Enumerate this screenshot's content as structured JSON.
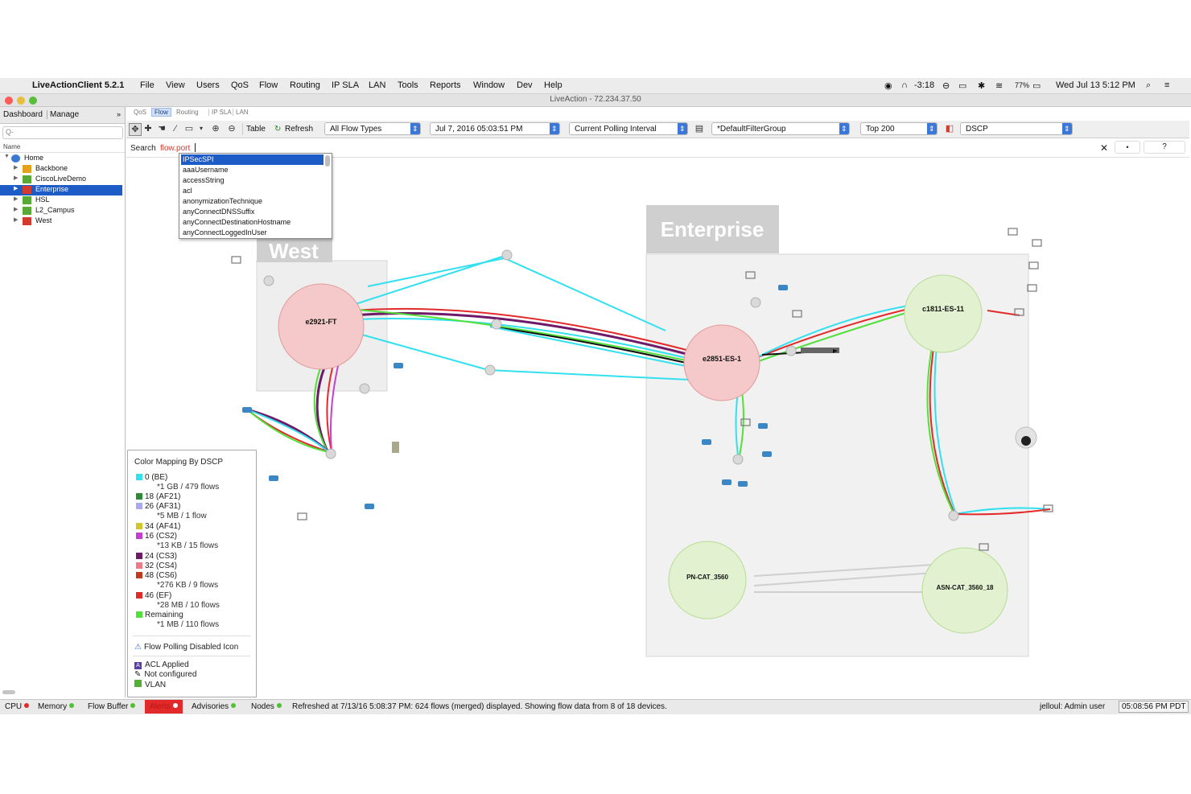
{
  "menubar": {
    "app_name": "LiveActionClient 5.2.1",
    "menus": [
      "File",
      "View",
      "Users",
      "QoS",
      "Flow",
      "Routing",
      "IP SLA",
      "LAN",
      "Tools",
      "Reports",
      "Window",
      "Dev",
      "Help"
    ],
    "time_remaining": "-3:18",
    "battery": "77%",
    "clock": "Wed Jul 13  5:12 PM"
  },
  "window": {
    "title": "LiveAction - 72.234.37.50"
  },
  "left_panel": {
    "tabs": [
      "Dashboard",
      "Manage"
    ],
    "search_placeholder": "Q-",
    "tree_header": "Name",
    "tree": [
      {
        "label": "Home",
        "color": "#3b78d4"
      },
      {
        "label": "Backbone",
        "color": "#e5a11c"
      },
      {
        "label": "CiscoLiveDemo",
        "color": "#58a935"
      },
      {
        "label": "Enterprise",
        "color": "#d33b2e"
      },
      {
        "label": "HSL",
        "color": "#58a935"
      },
      {
        "label": "L2_Campus",
        "color": "#58a935"
      },
      {
        "label": "West",
        "color": "#d33b2e"
      }
    ]
  },
  "view_tabs": [
    "QoS",
    "Flow",
    "Routing",
    "IP SLA",
    "LAN"
  ],
  "toolbar": {
    "table_label": "Table",
    "refresh_label": "Refresh",
    "flow_types": "All Flow Types",
    "datetime": "Jul 7, 2016 05:03:51 PM",
    "interval": "Current Polling Interval",
    "filter_group": "*DefaultFilterGroup",
    "top_n": "Top 200",
    "color_by": "DSCP"
  },
  "search": {
    "label": "Search",
    "query": "flow.port",
    "help": "?",
    "suggestions": [
      "IPSecSPI",
      "aaaUsername",
      "accessString",
      "acl",
      "anonymizationTechnique",
      "anyConnectDNSSuffix",
      "anyConnectDestinationHostname",
      "anyConnectLoggedInUser"
    ]
  },
  "map": {
    "groups": [
      {
        "name": "West"
      },
      {
        "name": "Enterprise"
      }
    ],
    "routers": [
      {
        "name": "e2921-FT",
        "color": "red"
      },
      {
        "name": "e2851-ES-1",
        "color": "red"
      },
      {
        "name": "c1811-ES-11",
        "color": "green"
      },
      {
        "name": "PN-CAT_3560",
        "color": "green"
      },
      {
        "name": "ASN-CAT_3560_18",
        "color": "green"
      }
    ]
  },
  "legend": {
    "title": "Color Mapping By DSCP",
    "entries": [
      {
        "label": "0 (BE)",
        "color": "#33e0ef",
        "detail": "*1 GB / 479 flows"
      },
      {
        "label": "18 (AF21)",
        "color": "#2f8a35",
        "detail": ""
      },
      {
        "label": "26 (AF31)",
        "color": "#a9a9ef",
        "detail": "*5 MB / 1 flow"
      },
      {
        "label": "34 (AF41)",
        "color": "#d2c62a",
        "detail": ""
      },
      {
        "label": "16 (CS2)",
        "color": "#c63ecf",
        "detail": "*13 KB / 15 flows"
      },
      {
        "label": "24 (CS3)",
        "color": "#6e1a68",
        "detail": ""
      },
      {
        "label": "32 (CS4)",
        "color": "#ef7a86",
        "detail": ""
      },
      {
        "label": "48 (CS6)",
        "color": "#c23a1e",
        "detail": "*276 KB / 9 flows"
      },
      {
        "label": "46 (EF)",
        "color": "#e22a2a",
        "detail": "*28 MB / 10 flows"
      },
      {
        "label": "Remaining",
        "color": "#52e03a",
        "detail": "*1 MB / 110 flows"
      }
    ],
    "flow_polling": "Flow Polling Disabled Icon",
    "icons": [
      "ACL Applied",
      "Not configured",
      "VLAN"
    ]
  },
  "status": {
    "cpu": "CPU",
    "memory": "Memory",
    "flow_buffer": "Flow Buffer",
    "alerts": "Alerts",
    "advisories": "Advisories",
    "nodes": "Nodes",
    "message": "Refreshed at 7/13/16 5:08:37 PM: 624 flows (merged) displayed.  Showing flow data from 8 of 18 devices.",
    "user": "jelloul: Admin user",
    "time": "05:08:56 PM PDT"
  },
  "colors": {
    "accent": "#1d5bc6",
    "alert": "#e22a2a"
  }
}
